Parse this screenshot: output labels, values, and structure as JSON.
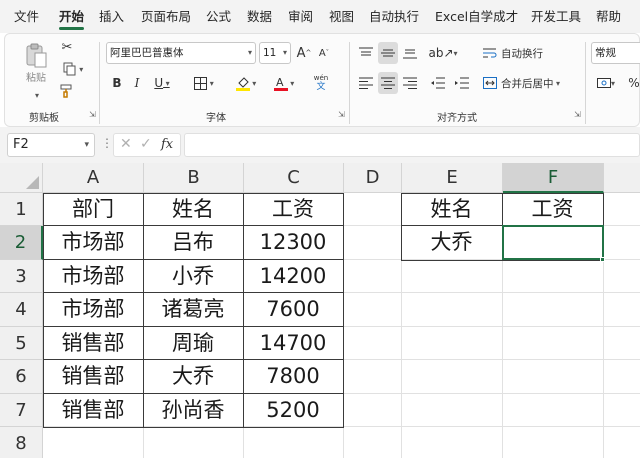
{
  "menu": {
    "items": [
      "文件",
      "开始",
      "插入",
      "页面布局",
      "公式",
      "数据",
      "审阅",
      "视图",
      "自动执行",
      "Excel自学成才",
      "开发工具",
      "帮助"
    ],
    "active": "开始"
  },
  "ribbon": {
    "clipboard": {
      "paste_label": "粘贴",
      "group_label": "剪贴板"
    },
    "font": {
      "font_name": "阿里巴巴普惠体",
      "font_size": "11",
      "bold": "B",
      "italic": "I",
      "underline": "U",
      "grow": "A",
      "shrink": "A",
      "phonetic": "wén",
      "group_label": "字体",
      "fill_color": "#FFE600",
      "font_color": "#E81123"
    },
    "alignment": {
      "wrap_label": "自动换行",
      "merge_label": "合并后居中",
      "group_label": "对齐方式"
    },
    "number": {
      "format": "常规"
    }
  },
  "formula_bar": {
    "name_box": "F2",
    "fx": "fx",
    "value": ""
  },
  "sheet": {
    "columns": [
      "A",
      "B",
      "C",
      "D",
      "E",
      "F"
    ],
    "selected_column": "F",
    "rows": [
      "1",
      "2",
      "3",
      "4",
      "5",
      "6",
      "7",
      "8"
    ],
    "selected_row": "2",
    "table1": {
      "headers": [
        "部门",
        "姓名",
        "工资"
      ],
      "rows": [
        [
          "市场部",
          "吕布",
          "12300"
        ],
        [
          "市场部",
          "小乔",
          "14200"
        ],
        [
          "市场部",
          "诸葛亮",
          "7600"
        ],
        [
          "销售部",
          "周瑜",
          "14700"
        ],
        [
          "销售部",
          "大乔",
          "7800"
        ],
        [
          "销售部",
          "孙尚香",
          "5200"
        ]
      ]
    },
    "table2": {
      "headers": [
        "姓名",
        "工资"
      ],
      "rows": [
        [
          "大乔",
          ""
        ]
      ]
    },
    "active_cell": "F2",
    "accent_color": "#217346"
  }
}
